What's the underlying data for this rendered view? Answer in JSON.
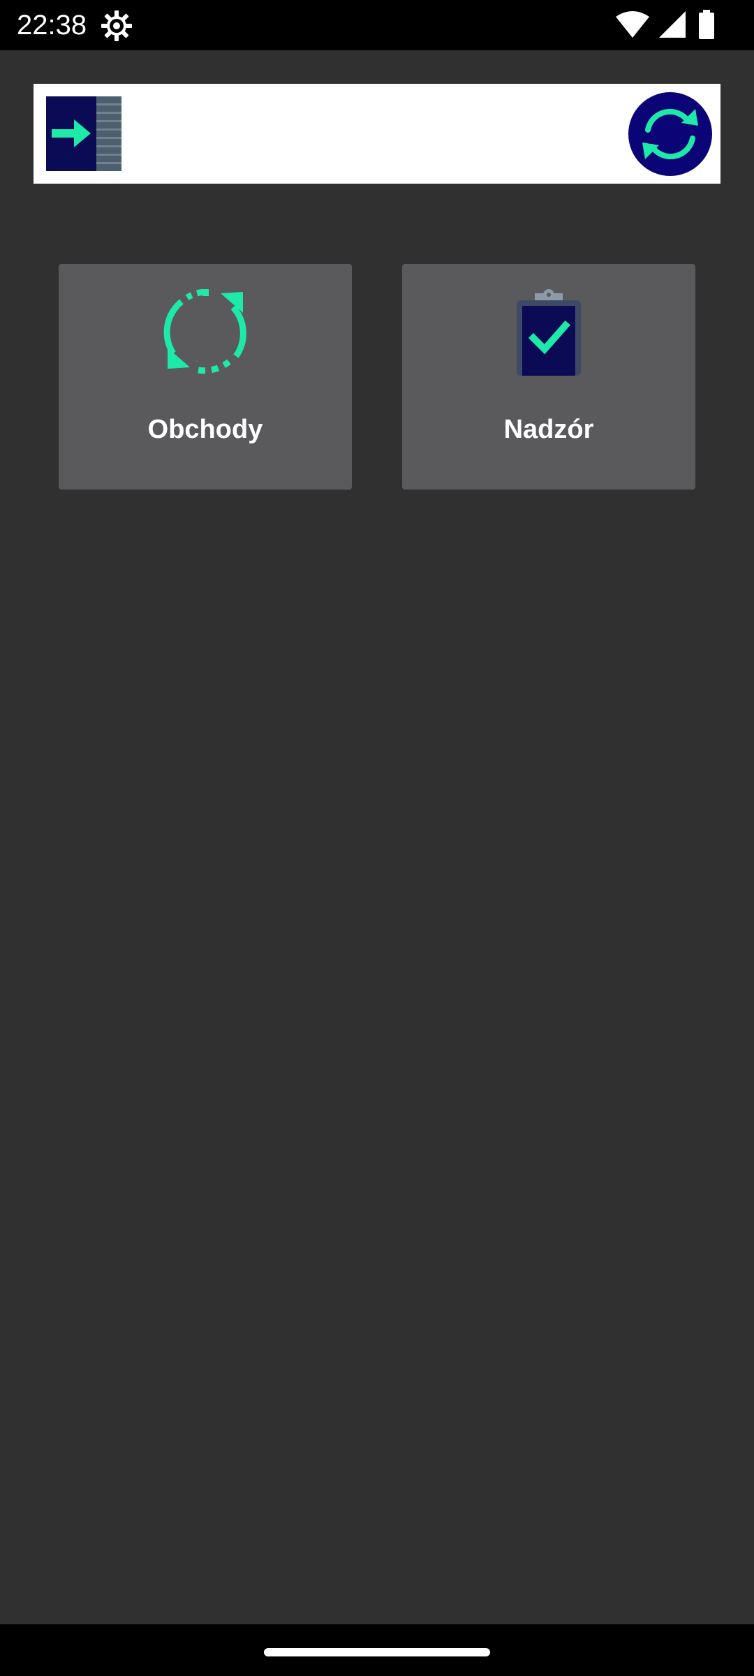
{
  "status_bar": {
    "time": "22:38",
    "icons": [
      "settings-gear-icon",
      "wifi-icon",
      "cellular-signal-icon",
      "battery-icon"
    ]
  },
  "header": {
    "logout_icon": "logout-arrow-icon",
    "sync_icon": "sync-icon"
  },
  "tiles": [
    {
      "label": "Obchody",
      "icon": "dashed-refresh-icon"
    },
    {
      "label": "Nadzór",
      "icon": "clipboard-check-icon"
    }
  ],
  "colors": {
    "accent": "#1de9a8",
    "navy": "#0b0477",
    "background": "#303030",
    "tile": "#5a5a5c"
  }
}
